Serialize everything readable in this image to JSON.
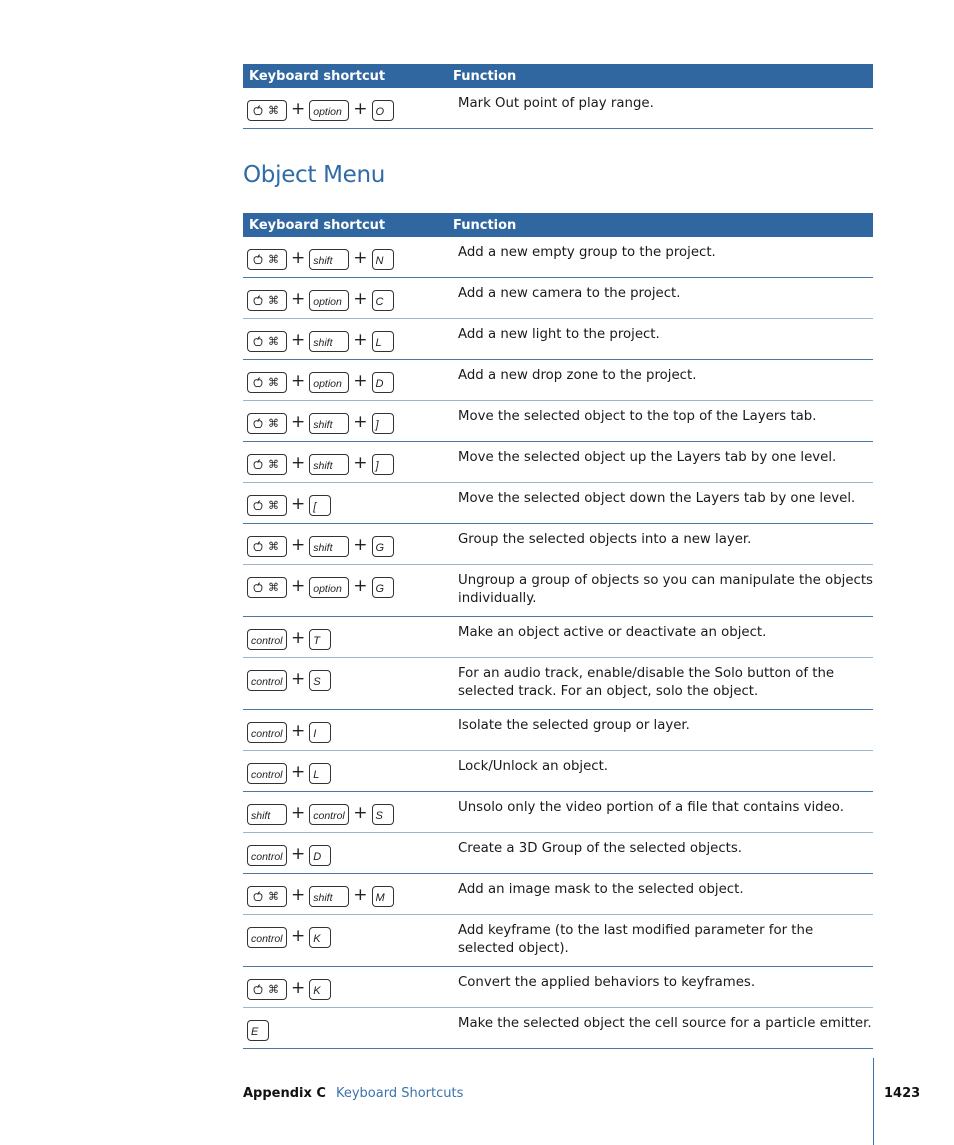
{
  "table_top": {
    "headers": [
      "Keyboard shortcut",
      "Function"
    ],
    "rows": [
      {
        "keys": [
          "cmd",
          "option",
          "O"
        ],
        "function": "Mark Out point of play range."
      }
    ]
  },
  "section_title": "Object Menu",
  "table_main": {
    "headers": [
      "Keyboard shortcut",
      "Function"
    ],
    "rows": [
      {
        "keys": [
          "cmd",
          "shift",
          "N"
        ],
        "function": "Add a new empty group to the project."
      },
      {
        "keys": [
          "cmd",
          "option",
          "C"
        ],
        "function": "Add a new camera to the project."
      },
      {
        "keys": [
          "cmd",
          "shift",
          "L"
        ],
        "function": "Add a new light to the project."
      },
      {
        "keys": [
          "cmd",
          "option",
          "D"
        ],
        "function": "Add a new drop zone to the project."
      },
      {
        "keys": [
          "cmd",
          "shift",
          "]"
        ],
        "function": "Move the selected object to the top of the Layers tab."
      },
      {
        "keys": [
          "cmd",
          "shift",
          "]"
        ],
        "function": "Move the selected object up the Layers tab by one level."
      },
      {
        "keys": [
          "cmd",
          "["
        ],
        "function": "Move the selected object down the Layers tab by one level."
      },
      {
        "keys": [
          "cmd",
          "shift",
          "G"
        ],
        "function": "Group the selected objects into a new layer."
      },
      {
        "keys": [
          "cmd",
          "option",
          "G"
        ],
        "function": "Ungroup a group of objects so you can manipulate the objects individually."
      },
      {
        "keys": [
          "control",
          "T"
        ],
        "function": "Make an object active or deactivate an object."
      },
      {
        "keys": [
          "control",
          "S"
        ],
        "function": "For an audio track, enable/disable the Solo button of the selected track. For an object, solo the object."
      },
      {
        "keys": [
          "control",
          "I"
        ],
        "function": "Isolate the selected group or layer."
      },
      {
        "keys": [
          "control",
          "L"
        ],
        "function": "Lock/Unlock an object."
      },
      {
        "keys": [
          "shift",
          "control",
          "S"
        ],
        "function": "Unsolo only the video portion of a file that contains video."
      },
      {
        "keys": [
          "control",
          "D"
        ],
        "function": "Create a 3D Group of the selected objects."
      },
      {
        "keys": [
          "cmd",
          "shift",
          "M"
        ],
        "function": "Add an image mask to the selected object."
      },
      {
        "keys": [
          "control",
          "K"
        ],
        "function": "Add keyframe (to the last modified parameter for the selected object)."
      },
      {
        "keys": [
          "cmd",
          "K"
        ],
        "function": "Convert the applied behaviors to keyframes."
      },
      {
        "keys": [
          "E"
        ],
        "function": "Make the selected object the cell source for a particle emitter."
      }
    ]
  },
  "icons": {
    "apple": " ἴF",
    "cmd_glyphs": [
      "⌘"
    ],
    "plus": "+"
  },
  "footer": {
    "appendix": "Appendix C",
    "section": "Keyboard Shortcuts",
    "page_number": "1423"
  },
  "colors": {
    "header_bg": "#3067a0",
    "title": "#2f6ba7",
    "link": "#3a73ad"
  }
}
